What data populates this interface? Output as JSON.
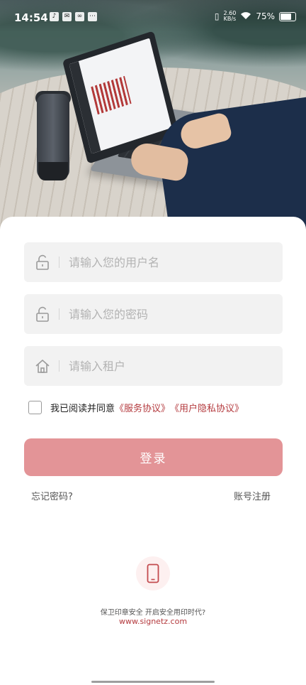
{
  "status_bar": {
    "time": "14:54",
    "net_speed_value": "2.60",
    "net_speed_unit": "KB/s",
    "battery": "75%"
  },
  "login_form": {
    "username_placeholder": "请输入您的用户名",
    "password_placeholder": "请输入您的密码",
    "tenant_placeholder": "请输入租户",
    "agree_text": "我已阅读并同意",
    "service_agreement": "《服务协议》",
    "privacy_agreement": "《用户隐私协议》",
    "login_button": "登录",
    "forgot_password": "忘记密码?",
    "register": "账号注册"
  },
  "footer": {
    "slogan": "保卫印章安全 开启安全用印时代?",
    "website": "www.signetz.com"
  },
  "colors": {
    "accent": "#b43a3e",
    "login_button": "#e39497"
  },
  "icons": {
    "username": "lock-icon",
    "password": "lock-icon",
    "tenant": "home-icon",
    "footer": "phone-icon"
  }
}
